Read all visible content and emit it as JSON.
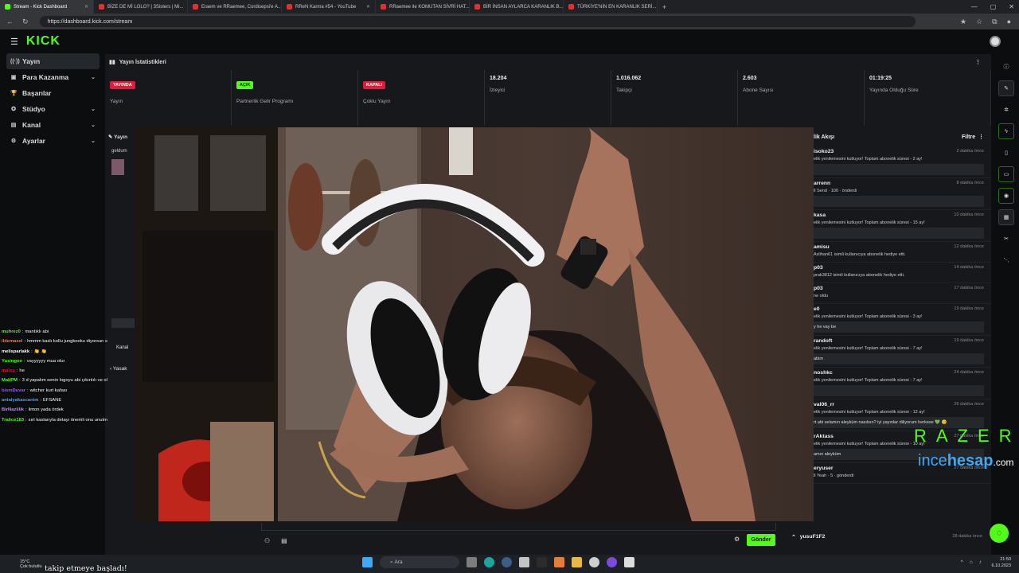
{
  "browser": {
    "tabs": [
      {
        "title": "Stream - Kick Dashboard",
        "active": true
      },
      {
        "title": "BİZE DE Mİ LOLO? | 3Sisters | Mi..."
      },
      {
        "title": "Eraem ve RRaemee, Cordisepsi'e A..."
      },
      {
        "title": "RReN Karma #54 - YouTube"
      },
      {
        "title": "RRaemee ile KOMUTAN SİVRİ HAT..."
      },
      {
        "title": "BİR İNSAN AYLARCA KARANLIK B..."
      },
      {
        "title": "TÜRKİYE'NİN EN KARANLIK SERİ..."
      }
    ],
    "url": "https://dashboard.kick.com/stream",
    "new_tab": "+"
  },
  "app": {
    "logo": "KICK",
    "sidebar": [
      {
        "label": "Yayın",
        "icon": "broadcast-icon",
        "glyph": "((·))",
        "active": true
      },
      {
        "label": "Para Kazanma",
        "icon": "money-icon",
        "glyph": "▣",
        "chevron": true
      },
      {
        "label": "Başarılar",
        "icon": "trophy-icon",
        "glyph": "🏆"
      },
      {
        "label": "Stüdyo",
        "icon": "studio-icon",
        "glyph": "✪",
        "chevron": true
      },
      {
        "label": "Kanal",
        "icon": "channel-icon",
        "glyph": "▤",
        "chevron": true
      },
      {
        "label": "Ayarlar",
        "icon": "settings-icon",
        "glyph": "⚙",
        "chevron": true
      }
    ],
    "stats_title": "Yayın İstatistikleri",
    "stats": [
      {
        "badge": "YAYINDA",
        "badge_color": "red",
        "label": "Yayın"
      },
      {
        "badge": "AÇIK",
        "badge_color": "green",
        "label": "Partnerlik Gelir Programı"
      },
      {
        "badge": "KAPALI",
        "badge_color": "red",
        "label": "Çoklu Yayın"
      },
      {
        "value": "18.204",
        "label": "İzleyici"
      },
      {
        "value": "1.016.062",
        "label": "Takipçi"
      },
      {
        "value": "2.603",
        "label": "Abone Sayısı"
      },
      {
        "value": "01:19:25",
        "label": "Yayında Olduğu Süre"
      }
    ],
    "left_panel": {
      "title": "Yayın",
      "text": "geldum",
      "kanal": "Kanal",
      "yasak": "Yasak"
    },
    "activity_title": "lik Akışı",
    "filter": "Filtre",
    "events": [
      {
        "user": "isoko23",
        "time": "2 dakika önce",
        "desc": "elik yenilemesini kutluyor! Toplam abonelik süresi - 2 ay!",
        "box": ""
      },
      {
        "user": "arrenn",
        "time": "8 dakika önce",
        "desc": "ll Send · 100 · önderdi",
        "box": ""
      },
      {
        "user": "kasa",
        "time": "10 dakika önce",
        "desc": "elik yenilemesini kutluyor! Toplam abonelik süresi - 15 ay!",
        "box": ""
      },
      {
        "user": "amisu",
        "time": "12 dakika önce",
        "desc": "Aslihan61 isimli kullanıcıya abonelik hediye etti.",
        "box": null
      },
      {
        "user": "p03",
        "time": "14 dakika önce",
        "desc": "prak3812 isimli kullanıcıya abonelik hediye etti.",
        "box": null
      },
      {
        "user": "p03",
        "time": "17 dakika önce",
        "desc": "ne oldu",
        "box": null
      },
      {
        "user": "e0",
        "time": "19 dakika önce",
        "desc": "elik yenilemesini kutluyor! Toplam abonelik süresi - 3 ay!",
        "box": "y he vay be"
      },
      {
        "user": "randoft",
        "time": "19 dakika önce",
        "desc": "elik yenilemesini kutluyor! Toplam abonelik süresi - 7 ay!",
        "box": "abim"
      },
      {
        "user": "noshkc",
        "time": "24 dakika önce",
        "desc": "elik yenilemesini kutluyor! Toplam abonelik süresi - 7 ay!",
        "box": ""
      },
      {
        "user": "val06_rr",
        "time": "26 dakika önce",
        "desc": "elik yenilemesini kutluyor! Toplam abonelik süresi - 12 ay!",
        "box": "rt abi selamın aleyküm nasılsın? iyi yayınlar diliyorum herkese 💚 😊"
      },
      {
        "user": "rAktass",
        "time": "27 dakika önce",
        "desc": "elik yenilemesini kutluyor! Toplam abonelik süresi - 10 ay!",
        "box": "amın aleyküm"
      },
      {
        "user": "eryuser",
        "time": "27 dakika önce",
        "desc": "ll Yeah · 5 · gönderdi",
        "box": null
      }
    ],
    "last_event": {
      "user": "yusuF1F2",
      "time": "28 dakika önce"
    },
    "send_label": "Gönder",
    "chat": [
      {
        "user": "muhrez0",
        "color": "#53fc18",
        "text": "mantıklı abi"
      },
      {
        "user": "ildemasel",
        "color": "#ff7a3c",
        "text": "hmmm kaslı kollu jungkooku diyorsun s"
      },
      {
        "user": "melisparlakk",
        "color": "#ffffff",
        "text": "👏 👏"
      },
      {
        "user": "Yusingoo",
        "color": "#53fc18",
        "text": "vayyyyyy mua olur"
      },
      {
        "user": "malsu",
        "color": "#e01b3c",
        "text": "he"
      },
      {
        "user": "MaliPM",
        "color": "#53fc18",
        "text": "3 d yapalım senin logoyu abi çıkıntılı ve ol"
      },
      {
        "user": "bismDuvar",
        "color": "#9b59ff",
        "text": "witcher kurt kafası"
      },
      {
        "user": "antalyakascanim",
        "color": "#3fa9f5",
        "text": "EFSANE"
      },
      {
        "user": "BirNazlilik",
        "color": "#c38cff",
        "text": "limon yada ördek"
      },
      {
        "user": "Tralice183",
        "color": "#53fc18",
        "text": "sırt kaslarıyla detayı önemli onu unutm"
      }
    ],
    "overlay": {
      "razer": "RAZER",
      "ince1": "ince",
      "ince2": "hesap",
      "ince3": ".com"
    }
  },
  "taskbar": {
    "weather": "15°C",
    "weather2": "Çok bulutlu",
    "search": "Ara",
    "time": "21:50",
    "date": "6.10.2023",
    "follow_text": "takip etmeye başladı!"
  }
}
